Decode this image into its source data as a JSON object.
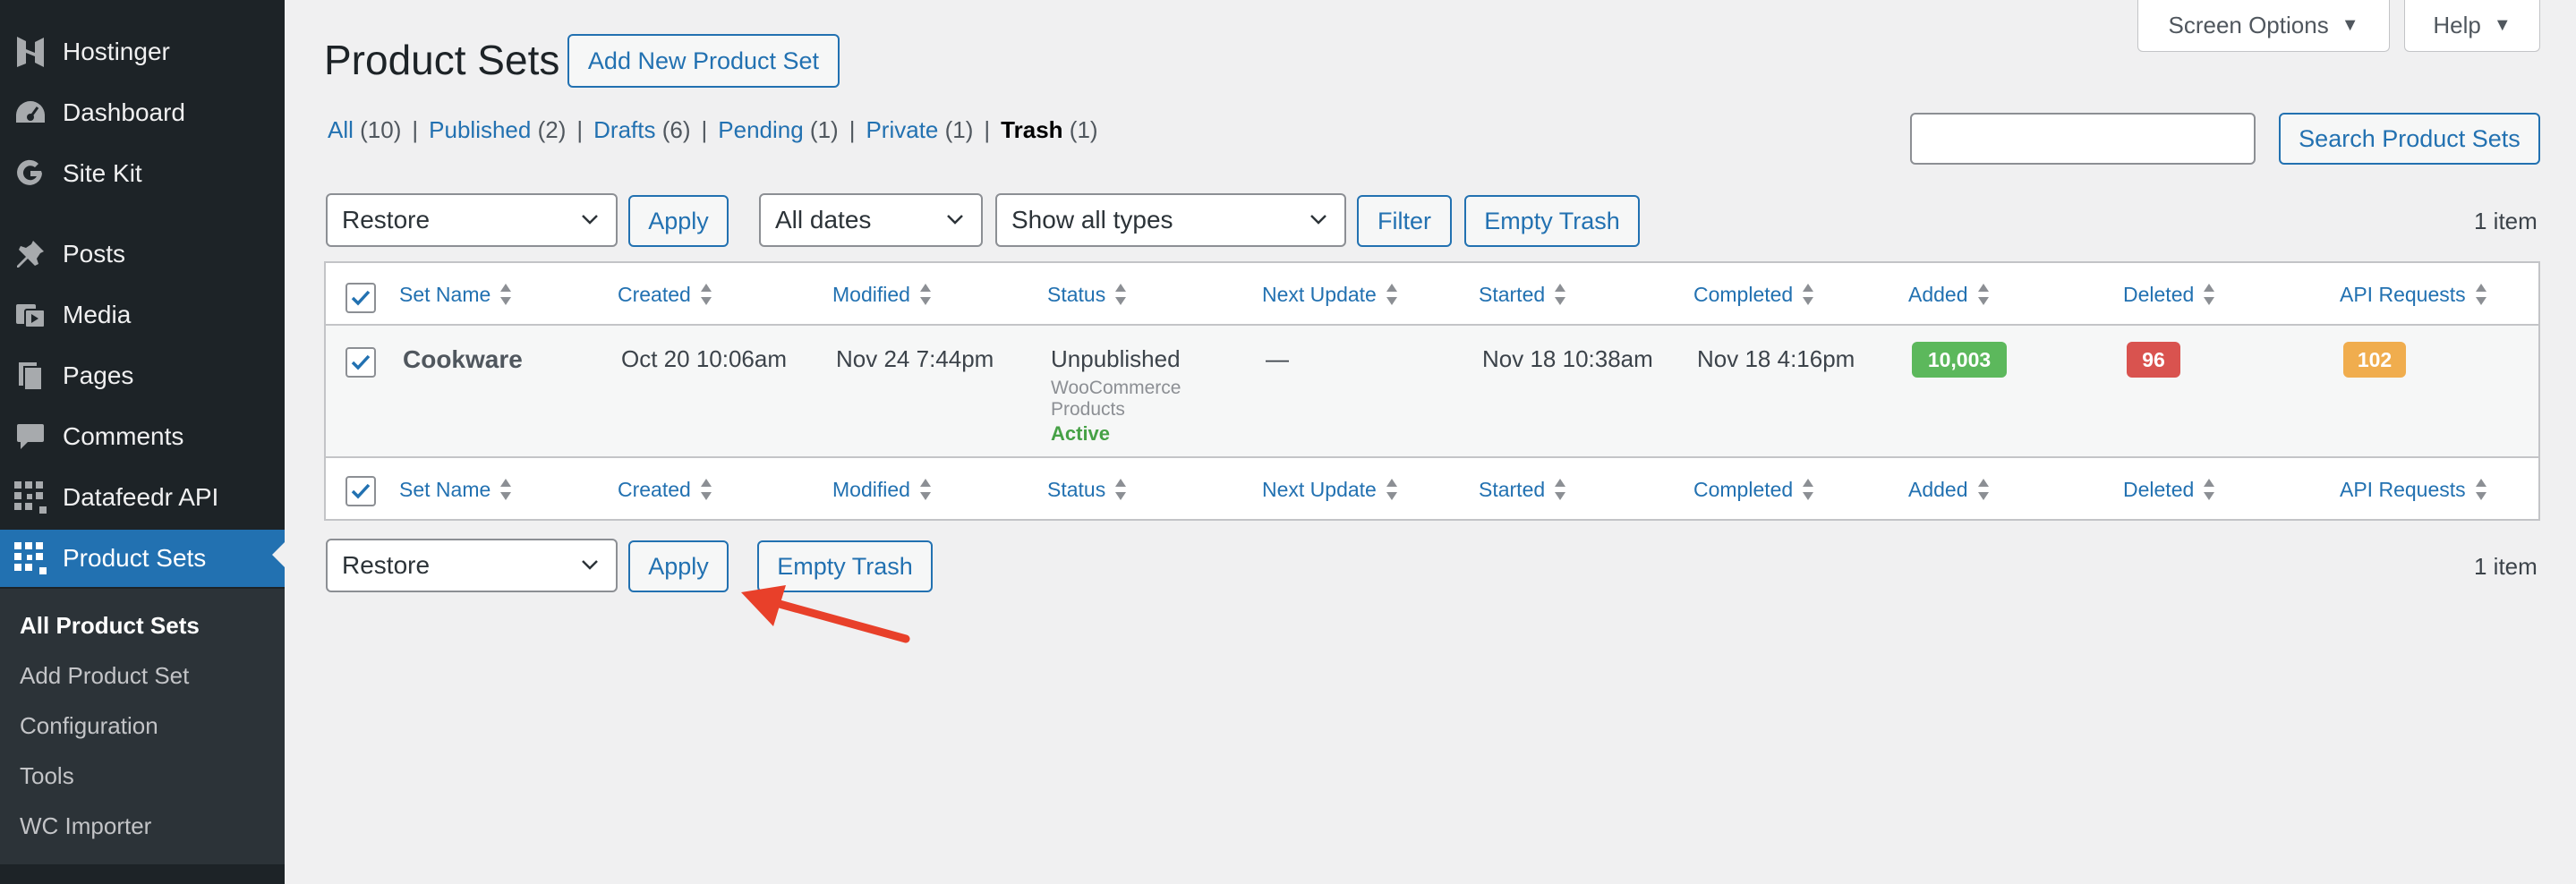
{
  "sidebar": {
    "items": [
      {
        "label": "Hostinger",
        "icon": "hostinger-icon"
      },
      {
        "label": "Dashboard",
        "icon": "dashboard-icon"
      },
      {
        "label": "Site Kit",
        "icon": "google-g-icon"
      },
      {
        "label": "Posts",
        "icon": "pin-icon"
      },
      {
        "label": "Media",
        "icon": "media-icon"
      },
      {
        "label": "Pages",
        "icon": "pages-icon"
      },
      {
        "label": "Comments",
        "icon": "comment-icon"
      },
      {
        "label": "Datafeedr API",
        "icon": "datafeedr-icon"
      },
      {
        "label": "Product Sets",
        "icon": "datafeedr-icon"
      }
    ],
    "submenu": [
      "All Product Sets",
      "Add Product Set",
      "Configuration",
      "Tools",
      "WC Importer"
    ]
  },
  "top": {
    "screen_options": "Screen Options",
    "help": "Help"
  },
  "page": {
    "title": "Product Sets",
    "add_new": "Add New Product Set"
  },
  "views": [
    {
      "label": "All",
      "count": "(10)"
    },
    {
      "label": "Published",
      "count": "(2)"
    },
    {
      "label": "Drafts",
      "count": "(6)"
    },
    {
      "label": "Pending",
      "count": "(1)"
    },
    {
      "label": "Private",
      "count": "(1)"
    },
    {
      "label": "Trash",
      "count": "(1)"
    }
  ],
  "search": {
    "button": "Search Product Sets"
  },
  "tablenav": {
    "bulk_action": "Restore",
    "apply": "Apply",
    "dates": "All dates",
    "types": "Show all types",
    "filter": "Filter",
    "empty_trash": "Empty Trash",
    "count": "1 item"
  },
  "columns": [
    "Set Name",
    "Created",
    "Modified",
    "Status",
    "Next Update",
    "Started",
    "Completed",
    "Added",
    "Deleted",
    "API Requests"
  ],
  "row": {
    "name": "Cookware",
    "created": "Oct 20 10:06am",
    "modified": "Nov 24 7:44pm",
    "status": "Unpublished",
    "status_sub1": "WooCommerce",
    "status_sub2": "Products",
    "status_active": "Active",
    "next_update": "—",
    "started": "Nov 18 10:38am",
    "completed": "Nov 18 4:16pm",
    "added": "10,003",
    "deleted": "96",
    "api_requests": "102"
  },
  "colors": {
    "accent": "#2271b1",
    "sidebar": "#1d2327",
    "added": "#5cb85c",
    "deleted": "#d9534f",
    "api": "#f0ad4e",
    "active": "#46a146",
    "arrow": "#e8402a"
  }
}
